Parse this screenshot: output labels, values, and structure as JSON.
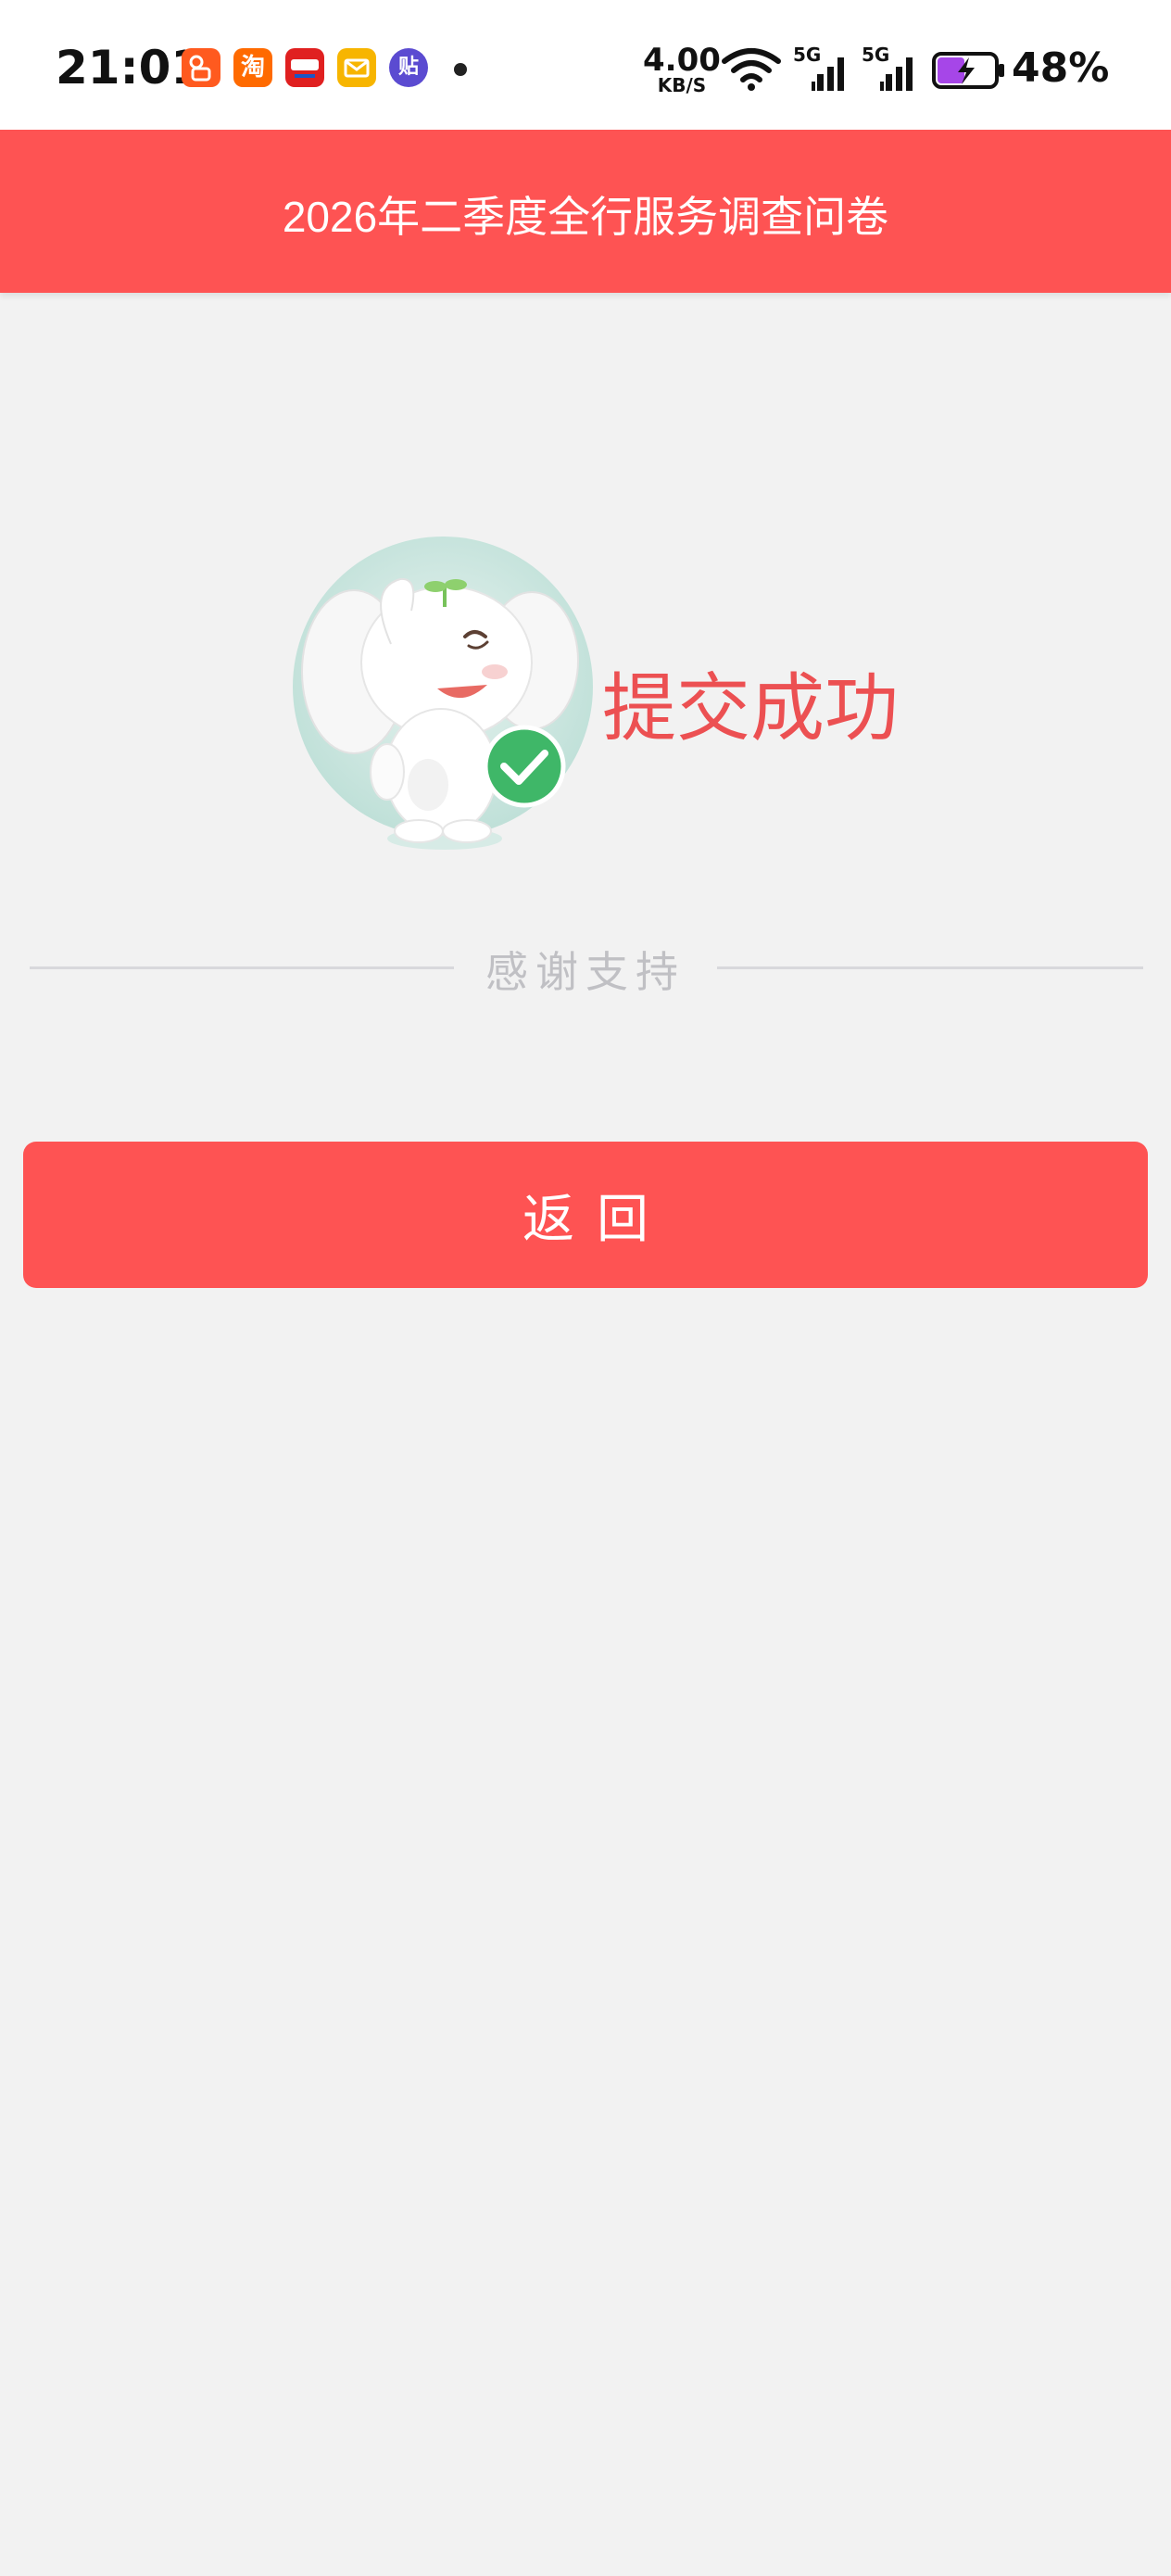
{
  "status_bar": {
    "time": "21:01",
    "notification_icons": [
      "kuaishou-icon",
      "taobao-icon",
      "yunshanfu-icon",
      "mail-icon",
      "tieba-icon"
    ],
    "net_speed_value": "4.00",
    "net_speed_unit": "KB/S",
    "signal_1_label": "5G",
    "signal_2_label": "5G",
    "battery_percent": "48%",
    "battery_level": 0.48
  },
  "header": {
    "title": "2026年二季度全行服务调查问卷"
  },
  "result": {
    "success_text": "提交成功",
    "thanks_text": "感谢支持"
  },
  "actions": {
    "back_label": "返回"
  },
  "colors": {
    "brand": "#fe5353",
    "success_text": "#ec5052",
    "background": "#f2f2f2",
    "check_green": "#3fb768"
  }
}
